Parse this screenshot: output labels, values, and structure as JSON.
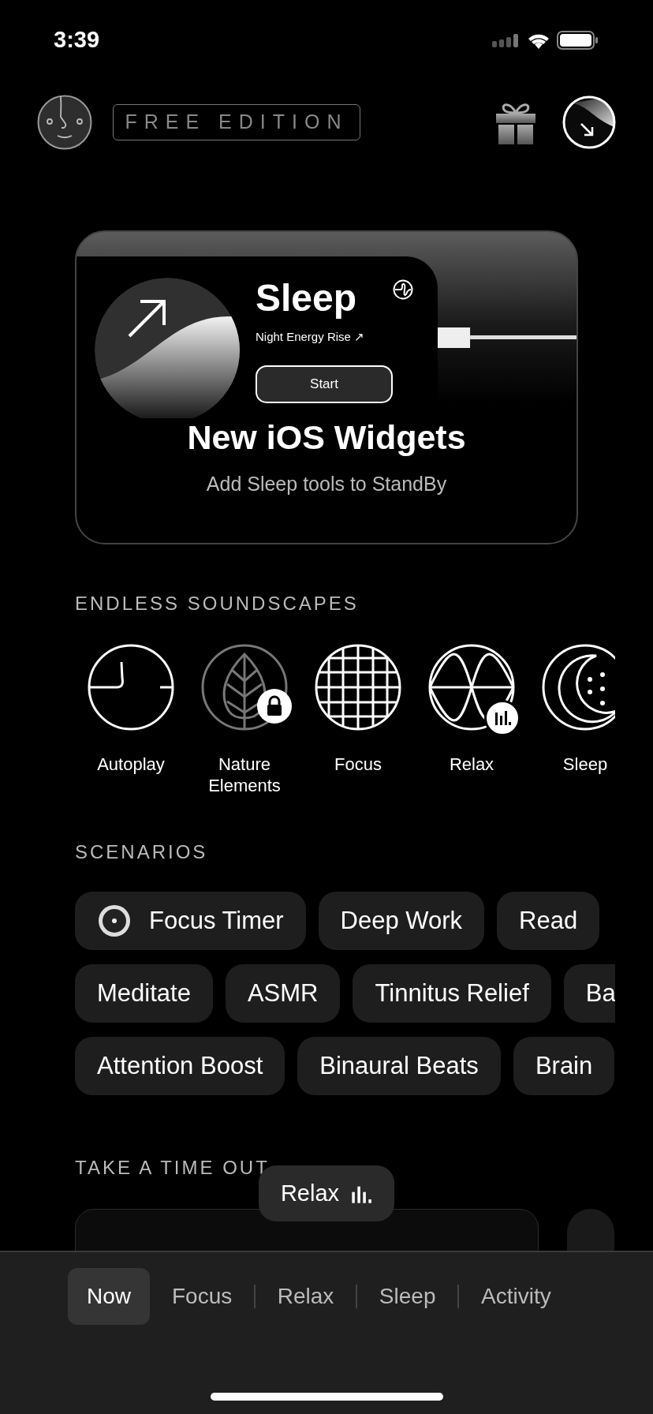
{
  "status_bar": {
    "time": "3:39"
  },
  "header": {
    "badge": "FREE EDITION"
  },
  "promo": {
    "widget": {
      "title": "Sleep",
      "subtitle": "Night Energy Rise ↗",
      "button": "Start"
    },
    "title": "New iOS Widgets",
    "subtitle": "Add Sleep tools to StandBy"
  },
  "soundscapes": {
    "heading": "ENDLESS SOUNDSCAPES",
    "items": [
      {
        "label": "Autoplay",
        "kind": "autoplay",
        "locked": false,
        "playing": false
      },
      {
        "label": "Nature Elements",
        "kind": "nature",
        "locked": true,
        "playing": false
      },
      {
        "label": "Focus",
        "kind": "focus",
        "locked": false,
        "playing": false
      },
      {
        "label": "Relax",
        "kind": "relax",
        "locked": false,
        "playing": true
      },
      {
        "label": "Sleep",
        "kind": "sleep",
        "locked": false,
        "playing": false
      }
    ]
  },
  "scenarios": {
    "heading": "SCENARIOS",
    "rows": [
      {
        "chips": [
          {
            "label": "Focus Timer",
            "kind": "timer"
          },
          {
            "label": "Deep Work",
            "kind": "plain"
          },
          {
            "label": "Read",
            "kind": "plain"
          }
        ]
      },
      {
        "chips": [
          {
            "label": "Meditate",
            "kind": "plain"
          },
          {
            "label": "ASMR",
            "kind": "plain"
          },
          {
            "label": "Tinnitus Relief",
            "kind": "plain"
          },
          {
            "label": "Ba",
            "kind": "plain"
          }
        ]
      },
      {
        "chips": [
          {
            "label": "Attention Boost",
            "kind": "plain"
          },
          {
            "label": "Binaural Beats",
            "kind": "plain"
          },
          {
            "label": "Brain",
            "kind": "plain"
          }
        ]
      }
    ]
  },
  "time_out": {
    "heading": "TAKE A TIME OUT"
  },
  "now_playing": {
    "label": "Relax"
  },
  "tabs": [
    {
      "label": "Now",
      "selected": true
    },
    {
      "label": "Focus",
      "selected": false
    },
    {
      "label": "Relax",
      "selected": false
    },
    {
      "label": "Sleep",
      "selected": false
    },
    {
      "label": "Activity",
      "selected": false
    }
  ]
}
